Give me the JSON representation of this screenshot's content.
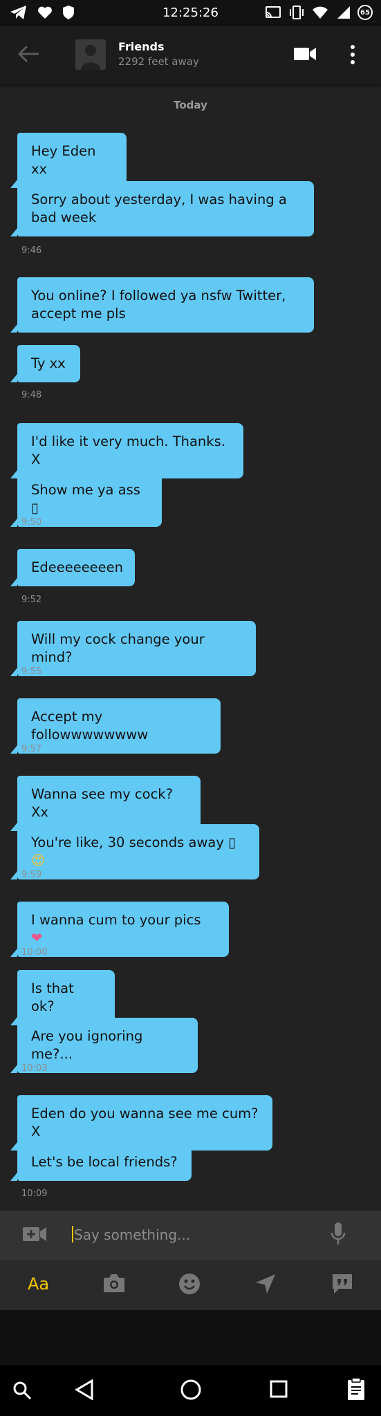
{
  "status_bar": {
    "time": "12:25:26",
    "battery_level": "65"
  },
  "header": {
    "title": "Friends",
    "subtitle": "2292 feet away"
  },
  "date_label": "Today",
  "messages": [
    {
      "text": "Hey Eden xx"
    },
    {
      "text": "Sorry about yesterday, I was having a bad week",
      "time": "9:46"
    },
    {
      "text": "You online? I followed ya nsfw Twitter, accept me pls"
    },
    {
      "text": "Ty xx",
      "time": "9:48"
    },
    {
      "text": "I'd like it very much. Thanks. X"
    },
    {
      "text": "Show me ya ass ▯",
      "time": "9:50"
    },
    {
      "text": "Edeeeeeeeen",
      "time": "9:52"
    },
    {
      "text": "Will my cock change your mind?",
      "time": "9:55"
    },
    {
      "text": "Accept my followwwwwwww",
      "time": "9:57"
    },
    {
      "text": "Wanna see my cock? Xx"
    },
    {
      "text": "You're like, 30 seconds away ▯",
      "emoji": "😍",
      "time": "9:59"
    },
    {
      "text": "I wanna cum to your pics",
      "emoji": "❤",
      "time": "10:00"
    },
    {
      "text": "Is that ok?"
    },
    {
      "text": "Are you ignoring me?...",
      "time": "10:03"
    },
    {
      "text": "Eden do you wanna see me cum? X"
    },
    {
      "text": "Let's be local friends?",
      "time": "10:09"
    }
  ],
  "composer": {
    "placeholder": "Say something..."
  },
  "toolbar": {
    "text_mode_label": "Aa"
  },
  "colors": {
    "bubble": "#62c9f5",
    "accent": "#f4c400",
    "background": "#222222"
  }
}
